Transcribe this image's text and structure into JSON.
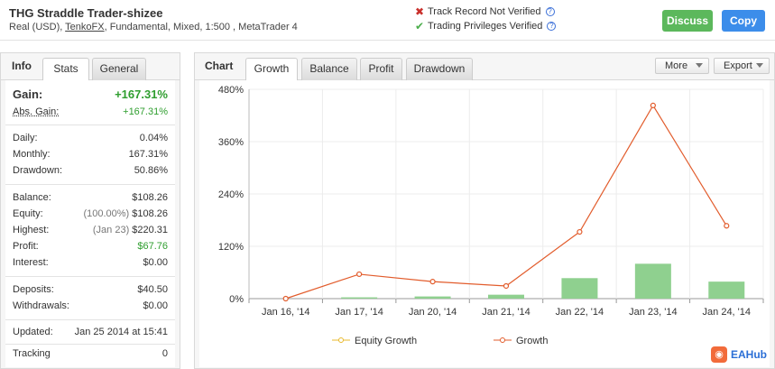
{
  "account": {
    "title": "THG Straddle Trader-shizee",
    "type": "Real (USD),",
    "broker": "TenkoFX",
    "details": ", Fundamental, Mixed, 1:500 , MetaTrader 4"
  },
  "verification": {
    "track_record": "Track Record Not Verified",
    "trading_privileges": "Trading Privileges Verified"
  },
  "actions": {
    "discuss": "Discuss",
    "copy": "Copy"
  },
  "left_tabs": {
    "label": "Info",
    "stats": "Stats",
    "general": "General"
  },
  "stats": {
    "gain": {
      "label": "Gain:",
      "value": "+167.31%"
    },
    "abs_gain": {
      "label": "Abs. Gain:",
      "value": "+167.31%"
    },
    "daily": {
      "label": "Daily:",
      "value": "0.04%"
    },
    "monthly": {
      "label": "Monthly:",
      "value": "167.31%"
    },
    "drawdown": {
      "label": "Drawdown:",
      "value": "50.86%"
    },
    "balance": {
      "label": "Balance:",
      "value": "$108.26"
    },
    "equity": {
      "label": "Equity:",
      "note": "(100.00%)",
      "value": "$108.26"
    },
    "highest": {
      "label": "Highest:",
      "note": "(Jan 23)",
      "value": "$220.31"
    },
    "profit": {
      "label": "Profit:",
      "value": "$67.76"
    },
    "interest": {
      "label": "Interest:",
      "value": "$0.00"
    },
    "deposits": {
      "label": "Deposits:",
      "value": "$40.50"
    },
    "withdrawals": {
      "label": "Withdrawals:",
      "value": "$0.00"
    },
    "updated": {
      "label": "Updated:",
      "value": "Jan 25 2014 at 15:41"
    },
    "tracking": {
      "label": "Tracking",
      "value": "0"
    }
  },
  "chart_tabs": {
    "label": "Chart",
    "growth": "Growth",
    "balance": "Balance",
    "profit": "Profit",
    "drawdown": "Drawdown",
    "more": "More",
    "export": "Export"
  },
  "chart_data": {
    "type": "line",
    "categories": [
      "Jan 16, '14",
      "Jan 17, '14",
      "Jan 20, '14",
      "Jan 21, '14",
      "Jan 22, '14",
      "Jan 23, '14",
      "Jan 24, '14"
    ],
    "y_ticks": [
      "0%",
      "120%",
      "240%",
      "360%",
      "480%"
    ],
    "ylim": [
      0,
      480
    ],
    "grid": true,
    "legend_placement": "bottom",
    "series": [
      {
        "name": "Equity Growth",
        "kind": "bar",
        "color": "#8fd08f",
        "values": [
          0,
          3,
          5,
          9,
          47,
          80,
          39
        ]
      },
      {
        "name": "Growth",
        "kind": "line",
        "color": "#e25c2c",
        "values": [
          0,
          56,
          39,
          29,
          153,
          443,
          167
        ]
      }
    ],
    "legend_colors": {
      "equity": "#e8b92c",
      "growth": "#e25c2c"
    }
  },
  "brand": {
    "logo_text": "EAHub"
  }
}
